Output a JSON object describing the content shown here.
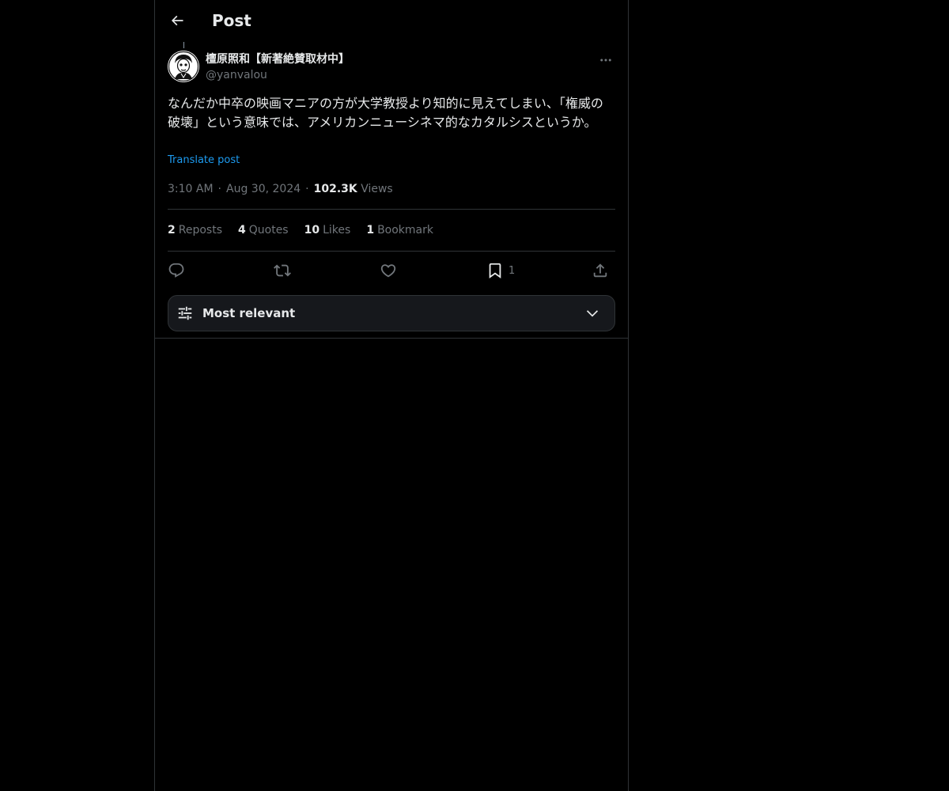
{
  "header": {
    "title": "Post",
    "back_icon": "arrow-left-icon"
  },
  "author": {
    "display_name": "檀原照和【新著絶賛取材中】",
    "handle": "@yanvalou",
    "more_icon": "more-horizontal-icon"
  },
  "post": {
    "text": "なんだか中卒の映画マニアの方が大学教授より知的に見えてしまい、「権威の破壊」という意味では、アメリカンニューシネマ的なカタルシスというか。",
    "translate_label": "Translate post",
    "time": "3:10 AM",
    "date": "Aug 30, 2024",
    "views_count": "102.3K",
    "views_label": "Views",
    "separator": "·"
  },
  "stats": [
    {
      "count": "2",
      "label": "Reposts"
    },
    {
      "count": "4",
      "label": "Quotes"
    },
    {
      "count": "10",
      "label": "Likes"
    },
    {
      "count": "1",
      "label": "Bookmark"
    }
  ],
  "actions": {
    "reply_icon": "reply-icon",
    "repost_icon": "repost-icon",
    "like_icon": "heart-icon",
    "bookmark_icon": "bookmark-icon",
    "bookmark_count": "1",
    "share_icon": "share-icon"
  },
  "sort": {
    "label": "Most relevant",
    "icon": "sliders-icon",
    "chevron": "chevron-down-icon"
  },
  "colors": {
    "background": "#000000",
    "text": "#e7e9ea",
    "muted": "#71767b",
    "link": "#1d9bf0",
    "border": "#2f3336"
  }
}
